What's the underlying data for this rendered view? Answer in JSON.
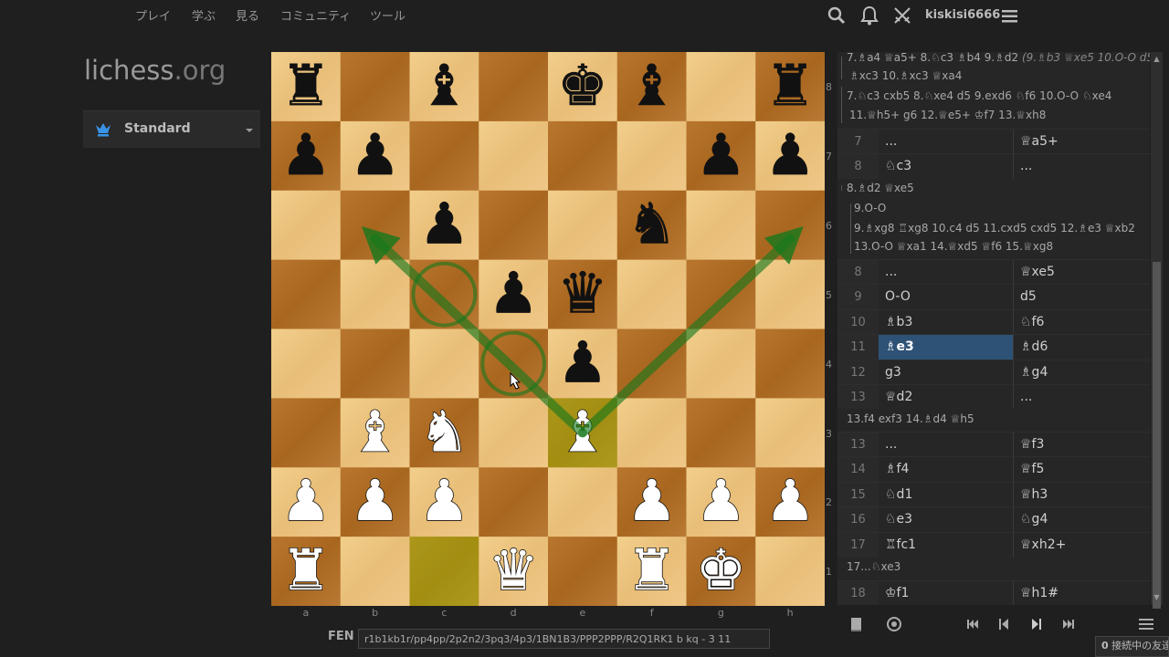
{
  "nav": {
    "items": [
      "プレイ",
      "学ぶ",
      "見る",
      "コミュニティ",
      "ツール"
    ],
    "username": "kiskisi6666"
  },
  "logo": {
    "main": "lichess",
    "suffix": ".org"
  },
  "variant": {
    "label": "Standard"
  },
  "board": {
    "files": [
      "a",
      "b",
      "c",
      "d",
      "e",
      "f",
      "g",
      "h"
    ],
    "ranks": [
      "8",
      "7",
      "6",
      "5",
      "4",
      "3",
      "2",
      "1"
    ],
    "fen": "r1b1kb1r/pp4pp/2p2n2/3pq3/4p3/1BN1B3/PPP2PPP/R2Q1RK1 b kq - 3 11",
    "highlight_squares": [
      "c1",
      "e3"
    ],
    "arrows": [
      [
        "e3",
        "b6"
      ],
      [
        "e3",
        "h6"
      ]
    ],
    "circles": [
      "c5",
      "d4"
    ],
    "light_color": "#f0d9b5",
    "dark_color": "#b58863"
  },
  "fen_label": "FEN",
  "fen_value": "r1b1kb1r/pp4pp/2p2n2/3pq3/4p3/1BN1B3/PPP2PPP/R2Q1RK1 b kq - 3 11",
  "moves": {
    "comment1": {
      "line1_pre": "7.♗a4 ♕a5+ 8.♘c3 ♗b4 9.♗d2",
      "line1_ital": "(9.♗b3 ♕xe5 10.O-O d5)",
      "line2": "♗xc3 10.♗xc3 ♕xa4",
      "line3": "7.♘c3 cxb5 8.♘xe4 d5 9.exd6 ♘f6 10.O-O ♘xe4",
      "line4": "11.♕h5+ g6 12.♕e5+ ♔f7 13.♕xh8"
    },
    "rows_a": [
      {
        "num": "7",
        "w": "...",
        "b": "♕a5+"
      },
      {
        "num": "8",
        "w": "♘c3",
        "b": "..."
      }
    ],
    "comment2": {
      "line1": "8.♗d2 ♕xe5",
      "line2": "9.O-O",
      "line3": "9.♗xg8 ♖xg8 10.c4 d5 11.cxd5 cxd5 12.♗e3 ♕xb2",
      "line4": "13.O-O ♕xa1 14.♕xd5 ♕f6 15.♕xg8"
    },
    "rows_b": [
      {
        "num": "8",
        "w": "...",
        "b": "♕xe5"
      },
      {
        "num": "9",
        "w": "O-O",
        "b": "d5"
      },
      {
        "num": "10",
        "w": "♗b3",
        "b": "♘f6"
      },
      {
        "num": "11",
        "w": "♗e3",
        "b": "♗d6"
      },
      {
        "num": "12",
        "w": "g3",
        "b": "♗g4"
      },
      {
        "num": "13",
        "w": "♕d2",
        "b": "..."
      }
    ],
    "comment3": {
      "line1": "13.f4 exf3 14.♗d4 ♕h5"
    },
    "rows_c": [
      {
        "num": "13",
        "w": "...",
        "b": "♕f3"
      },
      {
        "num": "14",
        "w": "♗f4",
        "b": "♕f5"
      },
      {
        "num": "15",
        "w": "♘d1",
        "b": "♕h3"
      },
      {
        "num": "16",
        "w": "♘e3",
        "b": "♘g4"
      },
      {
        "num": "17",
        "w": "♖fc1",
        "b": "♕xh2+"
      }
    ],
    "comment4": {
      "line1": "17...♘xe3"
    },
    "rows_d": [
      {
        "num": "18",
        "w": "♔f1",
        "b": "♕h1#"
      }
    ]
  },
  "friends": {
    "count": "0",
    "label": "接続中の友達"
  },
  "icons": {
    "search": "search-icon",
    "bell": "bell-icon",
    "swords": "crossed-swords-icon",
    "menu": "hamburger-menu-icon"
  }
}
